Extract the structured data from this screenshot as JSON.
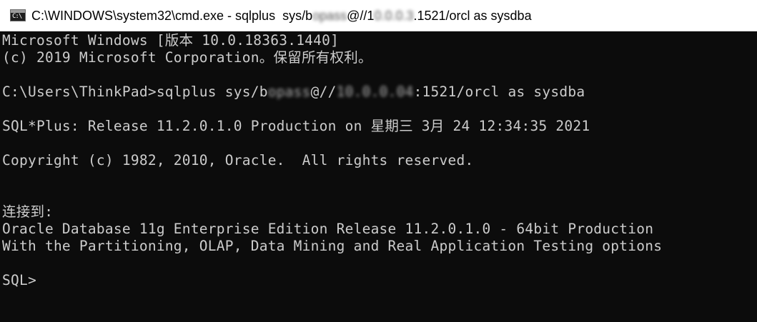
{
  "window": {
    "title_prefix": "C:\\WINDOWS\\system32\\cmd.exe - sqlplus  sys/b",
    "title_blur_1": "opass",
    "title_mid": "@//1",
    "title_blur_2": "0.0.0.3",
    "title_suffix": ".1521/orcl as sysdba",
    "icon_label": "C:\\"
  },
  "console": {
    "lines": [
      "Microsoft Windows [版本 10.0.18363.1440]",
      "(c) 2019 Microsoft Corporation。保留所有权利。",
      "",
      "C:\\Users\\ThinkPad>sqlplus sys/b",
      "",
      "SQL*Plus: Release 11.2.0.1.0 Production on 星期三 3月 24 12:34:35 2021",
      "",
      "Copyright (c) 1982, 2010, Oracle.  All rights reserved.",
      "",
      "",
      "连接到:",
      "Oracle Database 11g Enterprise Edition Release 11.2.0.1.0 - 64bit Production",
      "With the Partitioning, OLAP, Data Mining and Real Application Testing options",
      "",
      "SQL>"
    ],
    "command_blur_1": "opass",
    "command_mid": "@//",
    "command_blur_2": "10.0.0.04",
    "command_suffix": ":1521/orcl as sysdba"
  }
}
